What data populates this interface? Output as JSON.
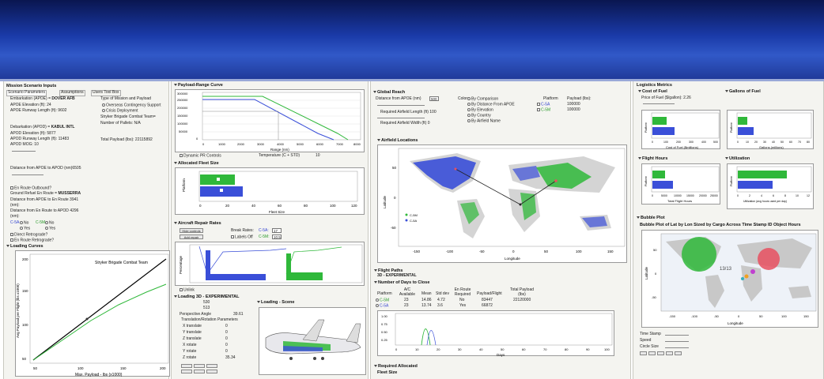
{
  "banner": {
    "color_top": "#0a1650",
    "color_mid": "#3159c8"
  },
  "left": {
    "title": "Mission Scenario Inputs",
    "tabs": [
      "Scenario Parameters",
      "Assumptions",
      "Users Tool Box"
    ],
    "embark_label": "Embarkation (APOE) =",
    "embark_value": "DOVER AFB",
    "apoe_elev": "APOE Elevation (ft): 24",
    "apoe_rwy": "APOE Runway Length (ft): 9602",
    "debark_label": "Debarkation (APOD) =",
    "debark_value": "KABUL INTL",
    "apod_elev": "APOD Elevation (ft): 5877",
    "apod_rwy": "APOD Runway Length (ft): 11483",
    "apod_mog": "APOD MOG: 10",
    "mission_type": "Type of Mission and Payload",
    "mission_opts": [
      "Overseas Contingency Support",
      "Crisis Deployment"
    ],
    "stryker": "Stryker Brigade Combat Team=",
    "pallets": "Number of Pallets: N/A",
    "payload": "Total Payload (lbs): 22115892",
    "dist": "Distance from APOE to APOD (nm)6505",
    "enroute_q": "En Route Outbound?",
    "refuel_label": "Ground Refuel En Route =",
    "refuel_value": "MUSSERRA",
    "d1": "Distance from APOE to En Route",
    "d1v": "3941",
    "d1u": "(nm):",
    "d2": "Distance from En Route to APOD",
    "d2v": "4296",
    "d2u": "(nm):",
    "c5a": "C-5A",
    "c5m": "C-5M",
    "no": "No",
    "yes": "Yes",
    "direct": "Direct Retrograde?",
    "enret": "En Route Retrograde?",
    "curves_title": "Loading Curves",
    "curves_sub": "Stryker Brigade Combat Team",
    "curves_ylabel": "Avg Payload per Flight (lbs x1000)",
    "curves_xlabel": "Max. Payload - lbs (x1000)",
    "curves_xticks": [
      "50",
      "100",
      "150",
      "200"
    ],
    "curves_yticks": [
      "50",
      "100",
      "150",
      "200"
    ]
  },
  "payload_range": {
    "title": "Payload-Range Curve",
    "ylabel": "Payload (lbs)",
    "xlabel": "Range (nm)",
    "yticks": [
      "300000",
      "250000",
      "200000",
      "150000",
      "100000",
      "50000",
      "0"
    ],
    "xticks": [
      "0",
      "1000",
      "2000",
      "3000",
      "4000",
      "5000",
      "6000",
      "7000",
      "8000"
    ],
    "dyn": "Dynamic PR Controls",
    "temp_label": "Temperature (C + STD)",
    "temp_value": "10"
  },
  "fleet": {
    "title": "Allocated Fleet Size",
    "ylabel": "Platform",
    "xlabel": "Fleet Size",
    "xticks": [
      "0",
      "20",
      "40",
      "60",
      "80",
      "100",
      "120"
    ]
  },
  "repair": {
    "title": "Aircraft Repair Rates",
    "break_label": "Break Rates:",
    "c5a": "C-5A:",
    "c5a_val": "17",
    "c5m": "C-5M:",
    "c5m_val": "10.5",
    "labels_off": "Labels Off",
    "btn1": "Hide controls",
    "btn2": "Add repair",
    "ylabel": "Percentage",
    "unlink": "Unlink"
  },
  "load3d": {
    "title": "Loading 3D - EXPERIMENTAL",
    "v1": "530",
    "v2": "513",
    "persp_label": "Perspective Angle",
    "persp_val": "39.61",
    "trans_title": "Translation/Rotation Parameters",
    "params": [
      [
        "X translate",
        "0"
      ],
      [
        "Y translate",
        "0"
      ],
      [
        "Z translate",
        "0"
      ],
      [
        "X rotate",
        "0"
      ],
      [
        "Y rotate",
        "0"
      ],
      [
        "Z rotate",
        "35.34"
      ]
    ],
    "scene_title": "Loading - Scene"
  },
  "global": {
    "title": "Global Reach",
    "dist_label": "Distance from APOE (nm)",
    "dist_val": "500",
    "req_len": "Required Airfield Length (ft)",
    "req_len_v": "100",
    "req_wid": "Required Airfield Width (ft)",
    "req_wid_v": "0",
    "color_label": "Color:",
    "color_opts": [
      "By Comparison",
      "By Distance From APOE",
      "By Elevation",
      "By Country",
      "By Airfield Name"
    ],
    "platform_h": "Platform",
    "payload_h": "Payload (lbs):",
    "plat1": "C-5A",
    "plat1v": "100000",
    "plat2": "C-5M",
    "plat2v": "100000",
    "airfield": "Airfield Locations",
    "ylabel": "Latitude",
    "xlabel": "Longitude",
    "xticks": [
      "-150",
      "-100",
      "-50",
      "0",
      "50",
      "100",
      "150"
    ],
    "yticks": [
      "50",
      "0",
      "-50"
    ],
    "legend": [
      "C-5M",
      "C-5A"
    ]
  },
  "flight": {
    "title": "Flight Paths",
    "sub": "3D - EXPERIMENTAL",
    "days_title": "Number of Days to Close",
    "headers": [
      "Platform",
      "A/C Available",
      "Mean",
      "Std dev",
      "En Route Required",
      "Payload/Flight",
      "Total Payload (lbs)"
    ],
    "rows": [
      [
        "C-5M",
        "23",
        "14.86",
        "4.72",
        "No",
        "83447",
        "22120000"
      ],
      [
        "C-5A",
        "23",
        "13.74",
        "3.6",
        "Yes",
        "66872",
        ""
      ]
    ],
    "ylabel": "Normalized",
    "xlabel": "Days",
    "xticks": [
      "0",
      "10",
      "20",
      "30",
      "40",
      "50",
      "60",
      "70",
      "80",
      "90",
      "100"
    ],
    "yticks": [
      "1.00",
      "0.75",
      "0.50",
      "0.25"
    ],
    "req_alloc": "Required Allocated",
    "fleet_size": "Fleet Size"
  },
  "logistics": {
    "title": "Logistics Metrics",
    "cost_title": "Cost of Fuel",
    "price_label": "Price of Fuel ($/gallon): 2.26",
    "cost_xlabel": "Cost of Fuel ($millions)",
    "cost_xticks": [
      "0",
      "100",
      "200",
      "300",
      "400",
      "500"
    ],
    "gallons_title": "Gallons of Fuel",
    "gallons_xlabel": "Gallons (millions)",
    "gallons_xticks": [
      "0",
      "10",
      "20",
      "30",
      "40",
      "50",
      "60",
      "70",
      "80"
    ],
    "hours_title": "Flight Hours",
    "hours_xlabel": "Total Flight Hours",
    "hours_xticks": [
      "0",
      "5000",
      "10000",
      "15000",
      "20000",
      "25000"
    ],
    "util_title": "Utilization",
    "util_xlabel": "Utilization (avg hours used per day)",
    "util_xticks": [
      "0",
      "2",
      "4",
      "6",
      "8",
      "10",
      "12"
    ],
    "platform": "Platform"
  },
  "bubble": {
    "title": "Bubble Plot",
    "sub": "Bubble Plot of Lat by Lon Sized by Cargo Across Time Stamp ID Object Hours",
    "ylabel": "Latitude",
    "xlabel": "Longitude",
    "xticks": [
      "-150",
      "-100",
      "-50",
      "0",
      "50",
      "100",
      "150"
    ],
    "yticks": [
      "50",
      "0",
      "-50"
    ],
    "bubble_label": "13/13",
    "time": "Time Stamp",
    "speed": "Speed",
    "circle": "Circle Size"
  },
  "colors": {
    "green": "#2fb83a",
    "blue": "#3a4fd8",
    "red": "#e85060"
  }
}
